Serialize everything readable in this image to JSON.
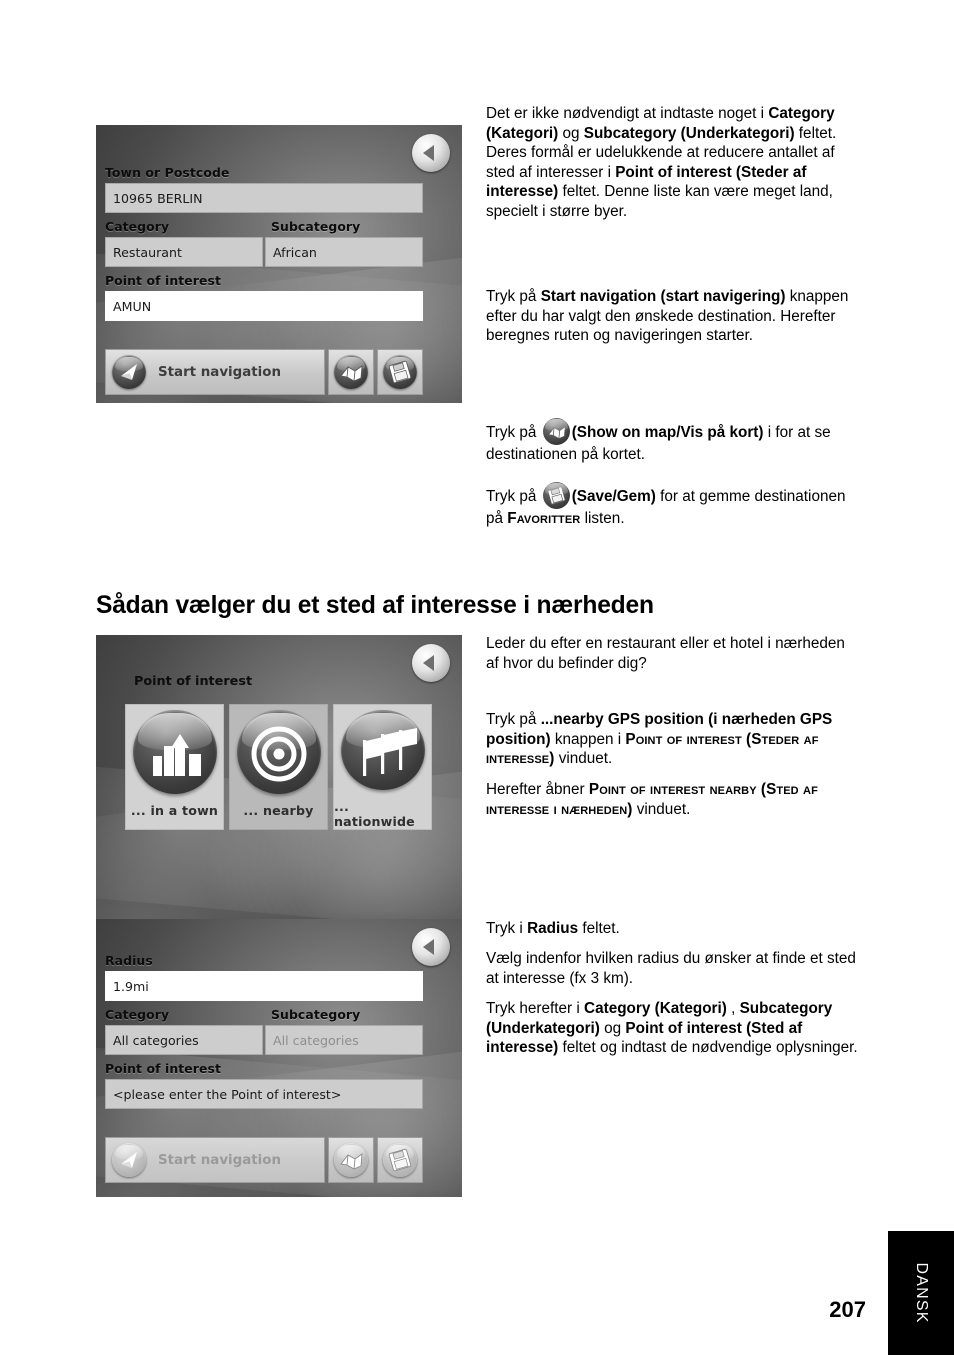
{
  "page": {
    "number": "207",
    "language_tab": "DANSK",
    "heading": "Sådan vælger du et sted af interesse i nærheden"
  },
  "screens": {
    "poi_town": {
      "back_icon": "back-arrow-icon",
      "fields": [
        {
          "label": "Town or Postcode",
          "value": "10965 BERLIN"
        },
        {
          "label": "Category",
          "value": "Restaurant"
        },
        {
          "label": "Subcategory",
          "value": "African"
        },
        {
          "label": "Point of interest",
          "value": "AMUN"
        }
      ],
      "toolbar": {
        "start_label": "Start navigation",
        "start_icon": "navigation-arrow-icon",
        "map_icon": "show-on-map-icon",
        "save_icon": "save-disk-icon"
      }
    },
    "poi_chooser": {
      "title": "Point of interest",
      "back_icon": "back-arrow-icon",
      "tiles": [
        {
          "label": "... in a town",
          "icon": "city-skyline-icon"
        },
        {
          "label": "... nearby",
          "icon": "target-rings-icon"
        },
        {
          "label": "... nationwide",
          "icon": "flags-icon"
        }
      ]
    },
    "poi_nearby": {
      "back_icon": "back-arrow-icon",
      "fields": [
        {
          "label": "Radius",
          "value": "1.9mi"
        },
        {
          "label": "Category",
          "value": "All categories"
        },
        {
          "label": "Subcategory",
          "value": "All categories"
        },
        {
          "label": "Point of interest",
          "value": "<please enter the Point of interest>"
        }
      ],
      "toolbar": {
        "start_label": "Start navigation",
        "start_icon": "navigation-arrow-icon",
        "map_icon": "show-on-map-icon",
        "save_icon": "save-disk-icon"
      }
    }
  },
  "body": {
    "p1": {
      "t1": "Det er ikke nødvendigt at indtaste noget i ",
      "b1": "Category (Kategori)",
      "t2": " og ",
      "b2": "Subcategory (Underkategori)",
      "t3": " feltet. Deres formål er udelukkende at reducere antallet af sted af interesser i ",
      "b3": "Point of interest (Steder af interesse)",
      "t4": " feltet. Denne liste kan være meget land, specielt i større byer."
    },
    "p2": {
      "t1": "Tryk på ",
      "b1": "Start navigation (start navigering)",
      "t2": " knappen efter du har valgt den ønskede destination. Herefter beregnes ruten og navigeringen starter."
    },
    "p3": {
      "t1": "Tryk på ",
      "b1": "(Show on map/Vis på kort)",
      "t2": " i for at se destinationen på kortet."
    },
    "p4": {
      "t1": "Tryk på ",
      "b1": "(Save/Gem)",
      "t2": " for at gemme destinationen på ",
      "sc1": "Favoritter",
      "t3": " listen."
    },
    "p5": {
      "t1": "Leder du efter en restaurant eller et hotel i nærheden af hvor du befinder dig?"
    },
    "p6": {
      "t1": "Tryk på ",
      "b1": "...nearby GPS position (i nærheden GPS position)",
      "t2": " knappen i ",
      "sc1": "Point of interest",
      "t3": " ",
      "sc2": "(Steder af interesse)",
      "t4": " vinduet."
    },
    "p7": {
      "t1": "Herefter åbner ",
      "sc1": "Point of interest nearby",
      "t2": " ",
      "sc2": "(Sted af interesse i nærheden)",
      "t3": " vinduet."
    },
    "p8": {
      "t1": "Tryk i ",
      "b1": "Radius",
      "t2": " feltet."
    },
    "p9": {
      "t1": "Vælg indenfor hvilken radius du ønsker at finde et sted at interesse (fx 3 km)."
    },
    "p10": {
      "t1": "Tryk herefter i ",
      "b1": "Category (Kategori)",
      "t2": " , ",
      "b2": "Subcategory (Underkategori)",
      "t3": " og ",
      "b3": "Point of interest (Sted af interesse)",
      "t4": " feltet og indtast de nødvendige oplysninger."
    }
  }
}
